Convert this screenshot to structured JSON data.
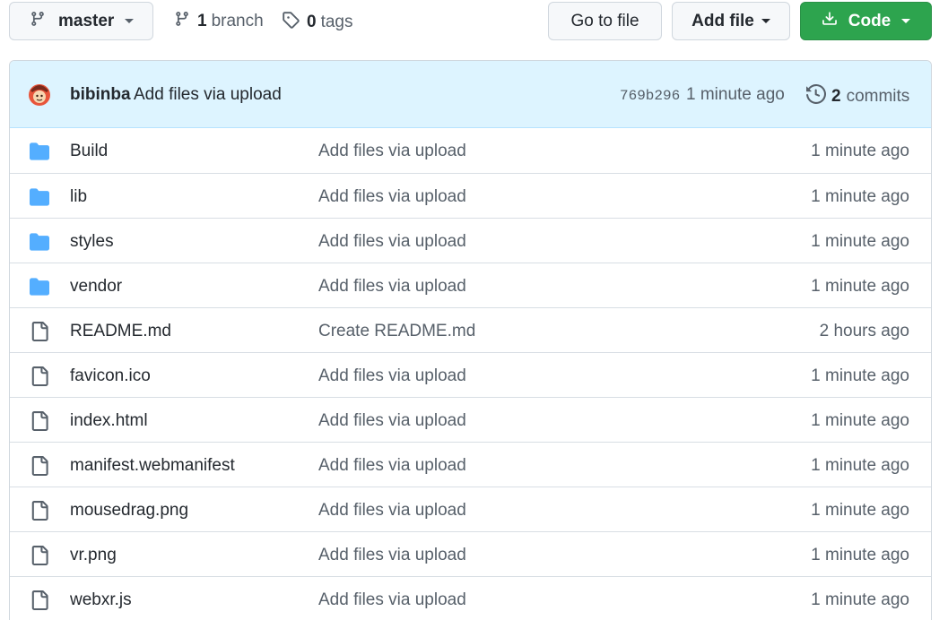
{
  "toolbar": {
    "branch_button": {
      "label": "master",
      "icon": "git-branch-icon"
    },
    "branches": {
      "count": "1",
      "label": "branch",
      "icon": "git-branch-icon"
    },
    "tags": {
      "count": "0",
      "label": "tags",
      "icon": "tag-icon"
    },
    "go_to_file": "Go to file",
    "add_file": "Add file",
    "code": {
      "label": "Code",
      "icon": "download-icon",
      "color": "#2da44e"
    }
  },
  "latest_commit": {
    "author": "bibinba",
    "message": "Add files via upload",
    "sha": "769b296",
    "time": "1 minute ago",
    "commits_count": "2",
    "commits_label": "commits",
    "history_icon": "history-icon",
    "bar_color": "#ddf4ff"
  },
  "files": [
    {
      "type": "folder",
      "name": "Build",
      "message": "Add files via upload",
      "time": "1 minute ago"
    },
    {
      "type": "folder",
      "name": "lib",
      "message": "Add files via upload",
      "time": "1 minute ago"
    },
    {
      "type": "folder",
      "name": "styles",
      "message": "Add files via upload",
      "time": "1 minute ago"
    },
    {
      "type": "folder",
      "name": "vendor",
      "message": "Add files via upload",
      "time": "1 minute ago"
    },
    {
      "type": "file",
      "name": "README.md",
      "message": "Create README.md",
      "time": "2 hours ago"
    },
    {
      "type": "file",
      "name": "favicon.ico",
      "message": "Add files via upload",
      "time": "1 minute ago"
    },
    {
      "type": "file",
      "name": "index.html",
      "message": "Add files via upload",
      "time": "1 minute ago"
    },
    {
      "type": "file",
      "name": "manifest.webmanifest",
      "message": "Add files via upload",
      "time": "1 minute ago"
    },
    {
      "type": "file",
      "name": "mousedrag.png",
      "message": "Add files via upload",
      "time": "1 minute ago"
    },
    {
      "type": "file",
      "name": "vr.png",
      "message": "Add files via upload",
      "time": "1 minute ago"
    },
    {
      "type": "file",
      "name": "webxr.js",
      "message": "Add files via upload",
      "time": "1 minute ago"
    }
  ],
  "colors": {
    "folder": "#54aeff",
    "file_icon": "#57606a",
    "border": "#d0d7de"
  }
}
